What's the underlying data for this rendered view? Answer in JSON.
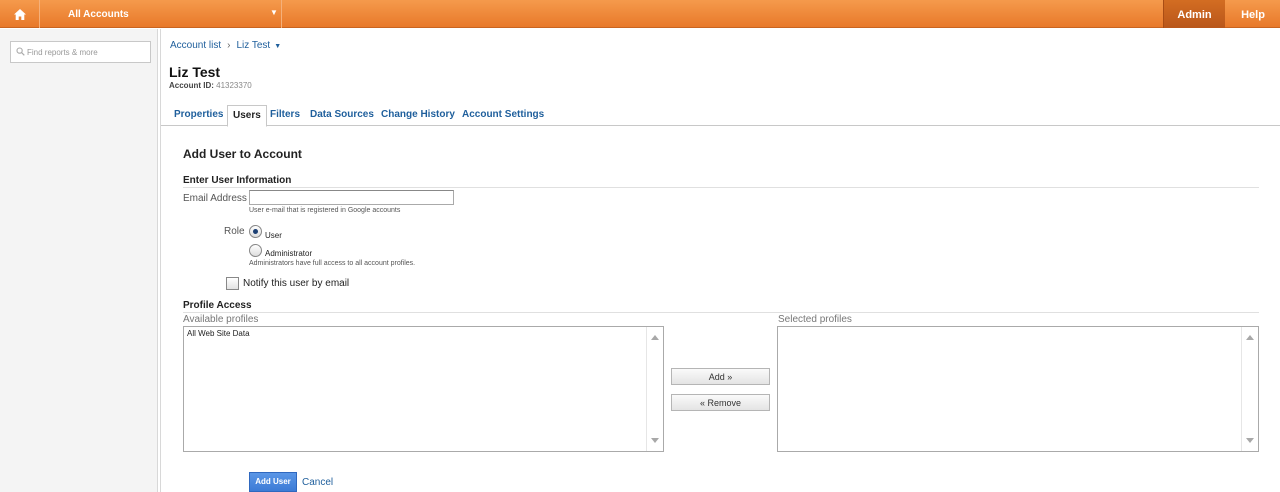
{
  "topbar": {
    "home_icon": "home-icon",
    "account_selector": "All Accounts",
    "admin": "Admin",
    "help": "Help"
  },
  "sidebar": {
    "search_placeholder": "Find reports & more"
  },
  "breadcrumb": {
    "root": "Account list",
    "separator": "›",
    "current": "Liz Test"
  },
  "account": {
    "name": "Liz Test",
    "id_label": "Account ID:",
    "id_value": "41323370"
  },
  "tabs": [
    {
      "label": "Properties"
    },
    {
      "label": "Users",
      "active": true
    },
    {
      "label": "Filters"
    },
    {
      "label": "Data Sources"
    },
    {
      "label": "Change History"
    },
    {
      "label": "Account Settings"
    }
  ],
  "form": {
    "title": "Add User to Account",
    "user_info_heading": "Enter User Information",
    "email_label": "Email Address",
    "email_value": "",
    "email_hint": "User e-mail that is registered in Google accounts",
    "role_label": "Role",
    "role_options": [
      {
        "label": "User",
        "checked": true
      },
      {
        "label": "Administrator",
        "checked": false
      }
    ],
    "admin_hint": "Administrators have full access to all account profiles.",
    "notify_label": "Notify this user by email",
    "notify_checked": false
  },
  "profile_access": {
    "heading": "Profile Access",
    "available_label": "Available profiles",
    "available_items": [
      "All Web Site Data"
    ],
    "selected_label": "Selected profiles",
    "selected_items": [],
    "add_button": "Add »",
    "remove_button": "« Remove"
  },
  "actions": {
    "submit": "Add User",
    "cancel": "Cancel"
  },
  "colors": {
    "topbar_orange": "#ee8a3c",
    "admin_active": "#c4601e",
    "link_blue": "#1f5f9c",
    "primary_button": "#4a88de"
  }
}
